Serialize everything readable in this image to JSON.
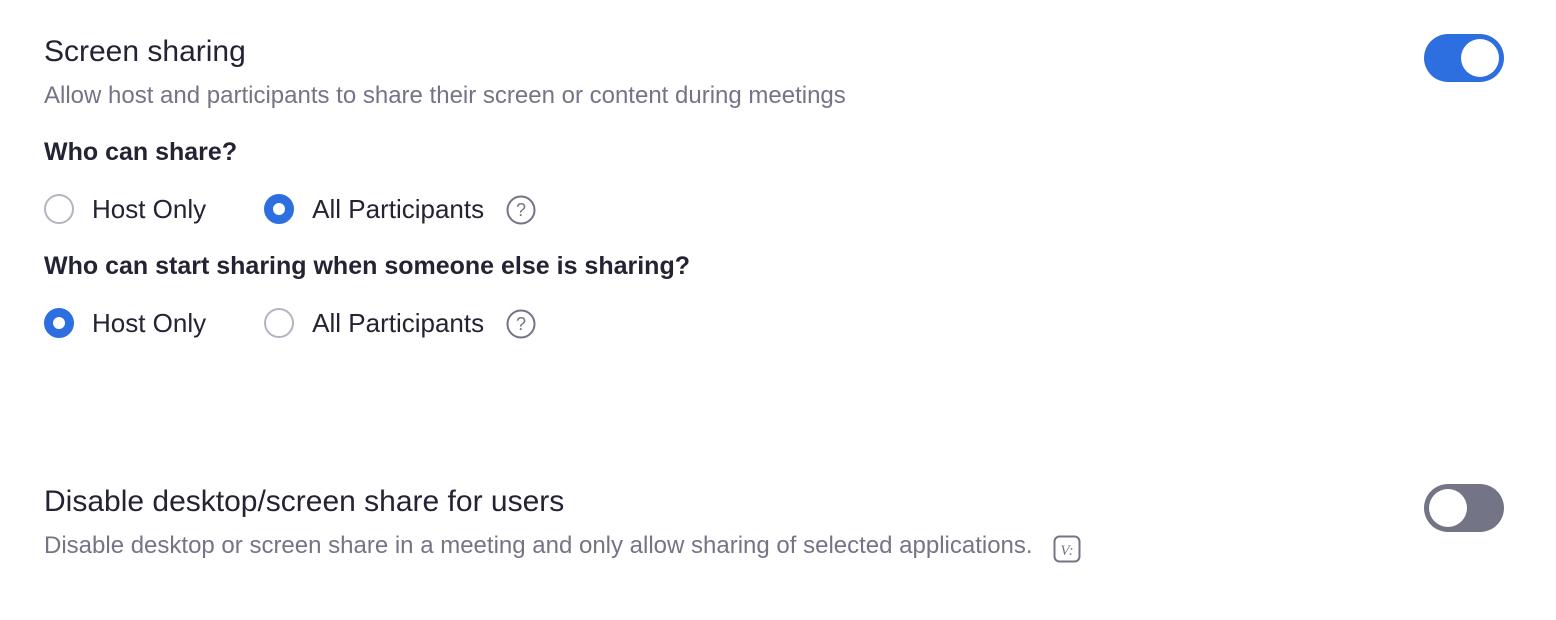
{
  "screen_sharing": {
    "title": "Screen sharing",
    "description": "Allow host and participants to share their screen or content during meetings",
    "enabled": true,
    "who_can_share": {
      "question": "Who can share?",
      "options": [
        "Host Only",
        "All Participants"
      ],
      "selected": "All Participants",
      "help_icon": "question-circle-icon"
    },
    "who_can_start_sharing": {
      "question": "Who can start sharing when someone else is sharing?",
      "options": [
        "Host Only",
        "All Participants"
      ],
      "selected": "Host Only",
      "help_icon": "question-circle-icon"
    }
  },
  "disable_desktop_share": {
    "title": "Disable desktop/screen share for users",
    "description": "Disable desktop or screen share in a meeting and only allow sharing of selected applications.",
    "enabled": false,
    "badge_icon": "version-badge-icon",
    "badge_text": "V:"
  },
  "colors": {
    "accent": "#2d6ee0",
    "toggle_off": "#747487",
    "text_primary": "#232333",
    "text_secondary": "#747487"
  }
}
